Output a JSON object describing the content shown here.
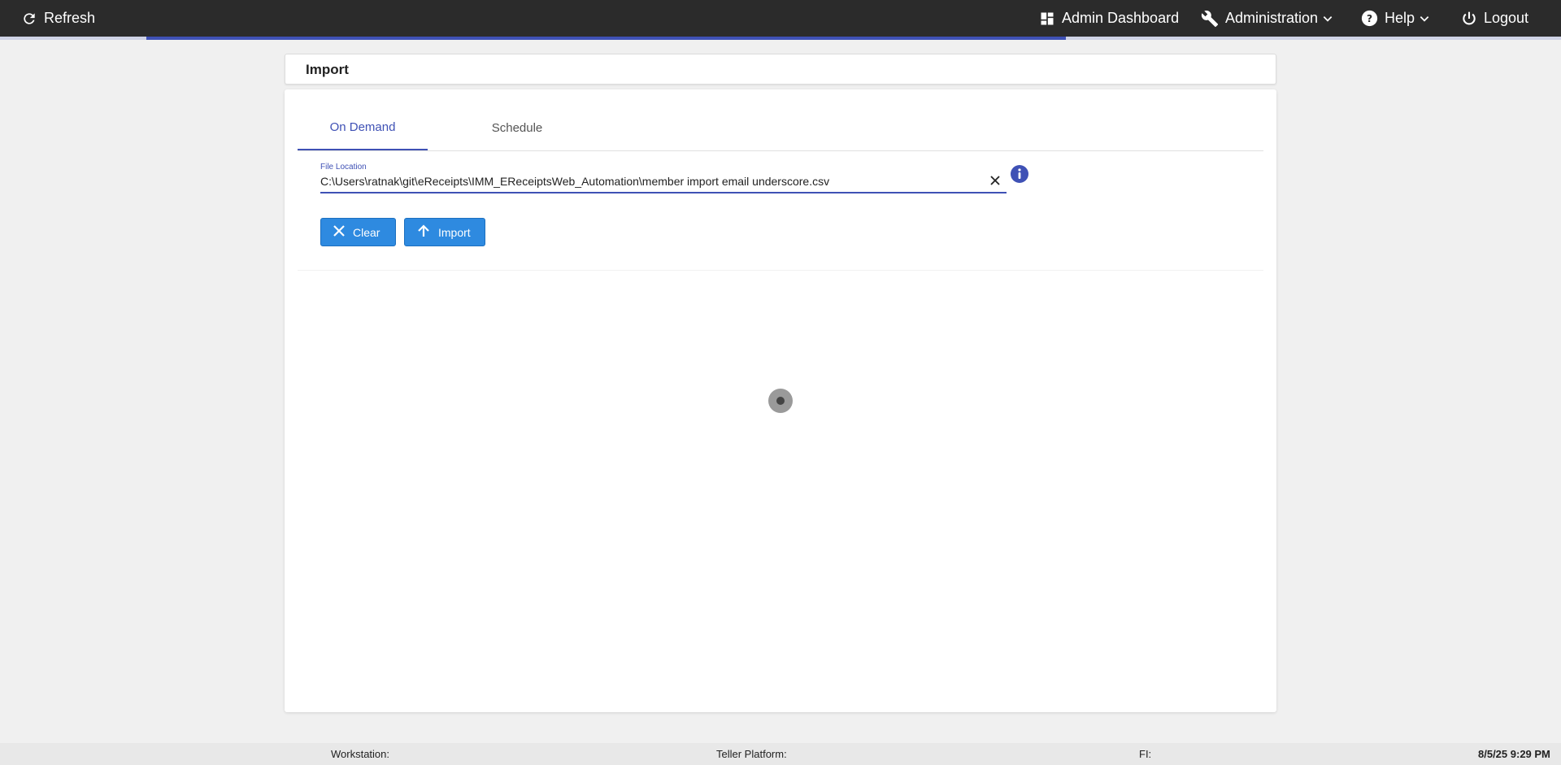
{
  "topbar": {
    "refresh_label": "Refresh",
    "admin_dashboard_label": "Admin Dashboard",
    "administration_label": "Administration",
    "help_label": "Help",
    "logout_label": "Logout",
    "icons": [
      "refresh-icon",
      "dashboard-icon",
      "wrench-icon",
      "help-circle-icon",
      "power-icon",
      "chevron-down-icon"
    ]
  },
  "page": {
    "title": "Import"
  },
  "tabs": [
    {
      "label": "On Demand",
      "active": true
    },
    {
      "label": "Schedule",
      "active": false
    }
  ],
  "file_field": {
    "label": "File Location",
    "value": "C:\\Users\\ratnak\\git\\eReceipts\\IMM_EReceiptsWeb_Automation\\member import email underscore.csv"
  },
  "buttons": {
    "clear_label": "Clear",
    "import_label": "Import"
  },
  "footer": {
    "workstation_label": "Workstation:",
    "teller_platform_label": "Teller Platform:",
    "fi_label": "FI:",
    "datetime": "8/5/25 9:29 PM"
  },
  "colors": {
    "topbar_bg": "#2b2b2b",
    "accent": "#3f51b5",
    "button_bg": "#2e8ae0"
  }
}
